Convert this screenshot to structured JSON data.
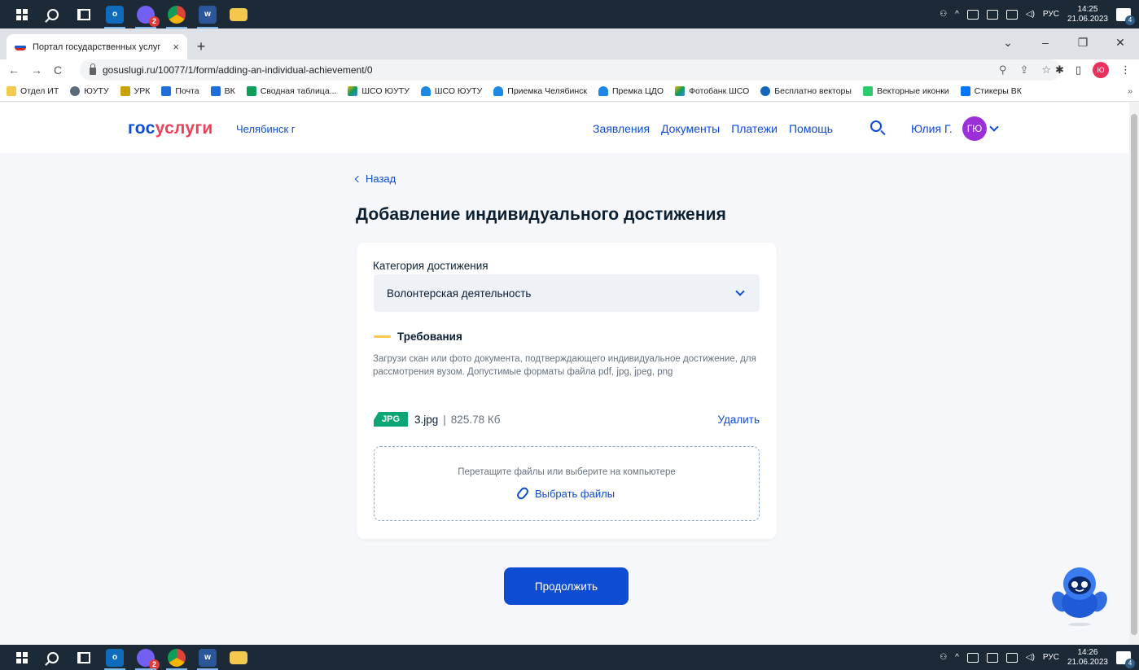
{
  "taskbar_top": {
    "outlook_label": "o",
    "viber_badge": "2",
    "word_label": "w",
    "lang": "РУС",
    "time": "14:25",
    "date": "21.06.2023",
    "notif_count": "4"
  },
  "taskbar_bottom": {
    "outlook_label": "o",
    "viber_badge": "2",
    "word_label": "w",
    "lang": "РУС",
    "time": "14:26",
    "date": "21.06.2023",
    "notif_count": "4"
  },
  "browser": {
    "tab_title": "Портал государственных услуг",
    "tab_close": "×",
    "new_tab": "+",
    "url": "gosuslugi.ru/10077/1/form/adding-an-individual-achievement/0",
    "profile_initials": "Ю",
    "bookmarks": [
      "Отдел ИТ",
      "ЮУТУ",
      "УРК",
      "Почта",
      "ВК",
      "Сводная таблица...",
      "ШСО ЮУТУ",
      "ШСО ЮУТУ",
      "Приемка Челябинск",
      "Премка ЦДО",
      "Фотобанк ШСО",
      "Бесплатно векторы",
      "Векторные иконки",
      "Стикеры ВК"
    ],
    "bookmarks_more": "»"
  },
  "header": {
    "logo_part1": "гос",
    "logo_part2": "услуги",
    "city": "Челябинск г",
    "nav": [
      "Заявления",
      "Документы",
      "Платежи",
      "Помощь"
    ],
    "user_name": "Юлия Г.",
    "avatar_initials": "ГЮ"
  },
  "form": {
    "back_label": "Назад",
    "title": "Добавление индивидуального достижения",
    "category_label": "Категория достижения",
    "category_value": "Волонтерская деятельность",
    "requirements_title": "Требования",
    "requirements_text": "Загрузи скан или фото документа, подтверждающего индивидуальное достижение, для рассмотрения вузом. Допустимые форматы файла pdf, jpg, jpeg, png",
    "file": {
      "type": "JPG",
      "name": "3.jpg",
      "separator": "|",
      "size": "825.78 Кб",
      "delete_label": "Удалить"
    },
    "dropzone_hint": "Перетащите файлы или выберите на компьютере",
    "choose_files_label": "Выбрать файлы",
    "continue_label": "Продолжить"
  },
  "colors": {
    "brand_blue": "#0d4cd3",
    "brand_red": "#ee3f58",
    "jpg_badge": "#0aa575",
    "requirements_accent": "#f9c94b"
  }
}
